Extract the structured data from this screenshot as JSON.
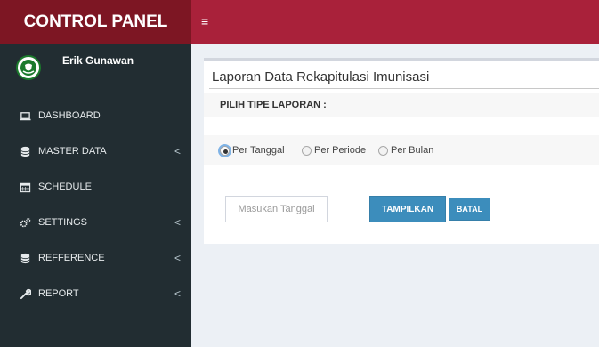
{
  "app": {
    "brand": "CONTROL PANEL"
  },
  "topbar": {
    "menu_icon": "hamburger-icon"
  },
  "user": {
    "name": "Erik Gunawan",
    "avatar_icon": "health-logo-icon"
  },
  "sidebar": {
    "items": [
      {
        "label": "DASHBOARD",
        "icon": "laptop-icon",
        "has_submenu": false
      },
      {
        "label": "MASTER DATA",
        "icon": "database-icon",
        "has_submenu": true
      },
      {
        "label": "SCHEDULE",
        "icon": "calendar-icon",
        "has_submenu": false
      },
      {
        "label": "SETTINGS",
        "icon": "cogs-icon",
        "has_submenu": true
      },
      {
        "label": "REFFERENCE",
        "icon": "database-icon",
        "has_submenu": true
      },
      {
        "label": "REPORT",
        "icon": "wrench-icon",
        "has_submenu": true
      }
    ],
    "chevron": "<"
  },
  "report": {
    "title": "Laporan Data Rekapitulasi Imunisasi",
    "type_heading": "PILIH TIPE LAPORAN :",
    "options": [
      {
        "label": "Per Tanggal",
        "selected": true
      },
      {
        "label": "Per Periode",
        "selected": false
      },
      {
        "label": "Per Bulan",
        "selected": false
      }
    ],
    "date_placeholder": "Masukan Tanggal",
    "submit_label": "TAMPILKAN",
    "cancel_label": "BATAL"
  },
  "colors": {
    "brand_bg": "#7d1623",
    "topbar_bg": "#a9213a",
    "sidebar_bg": "#222d32",
    "primary": "#3c8dbc"
  }
}
